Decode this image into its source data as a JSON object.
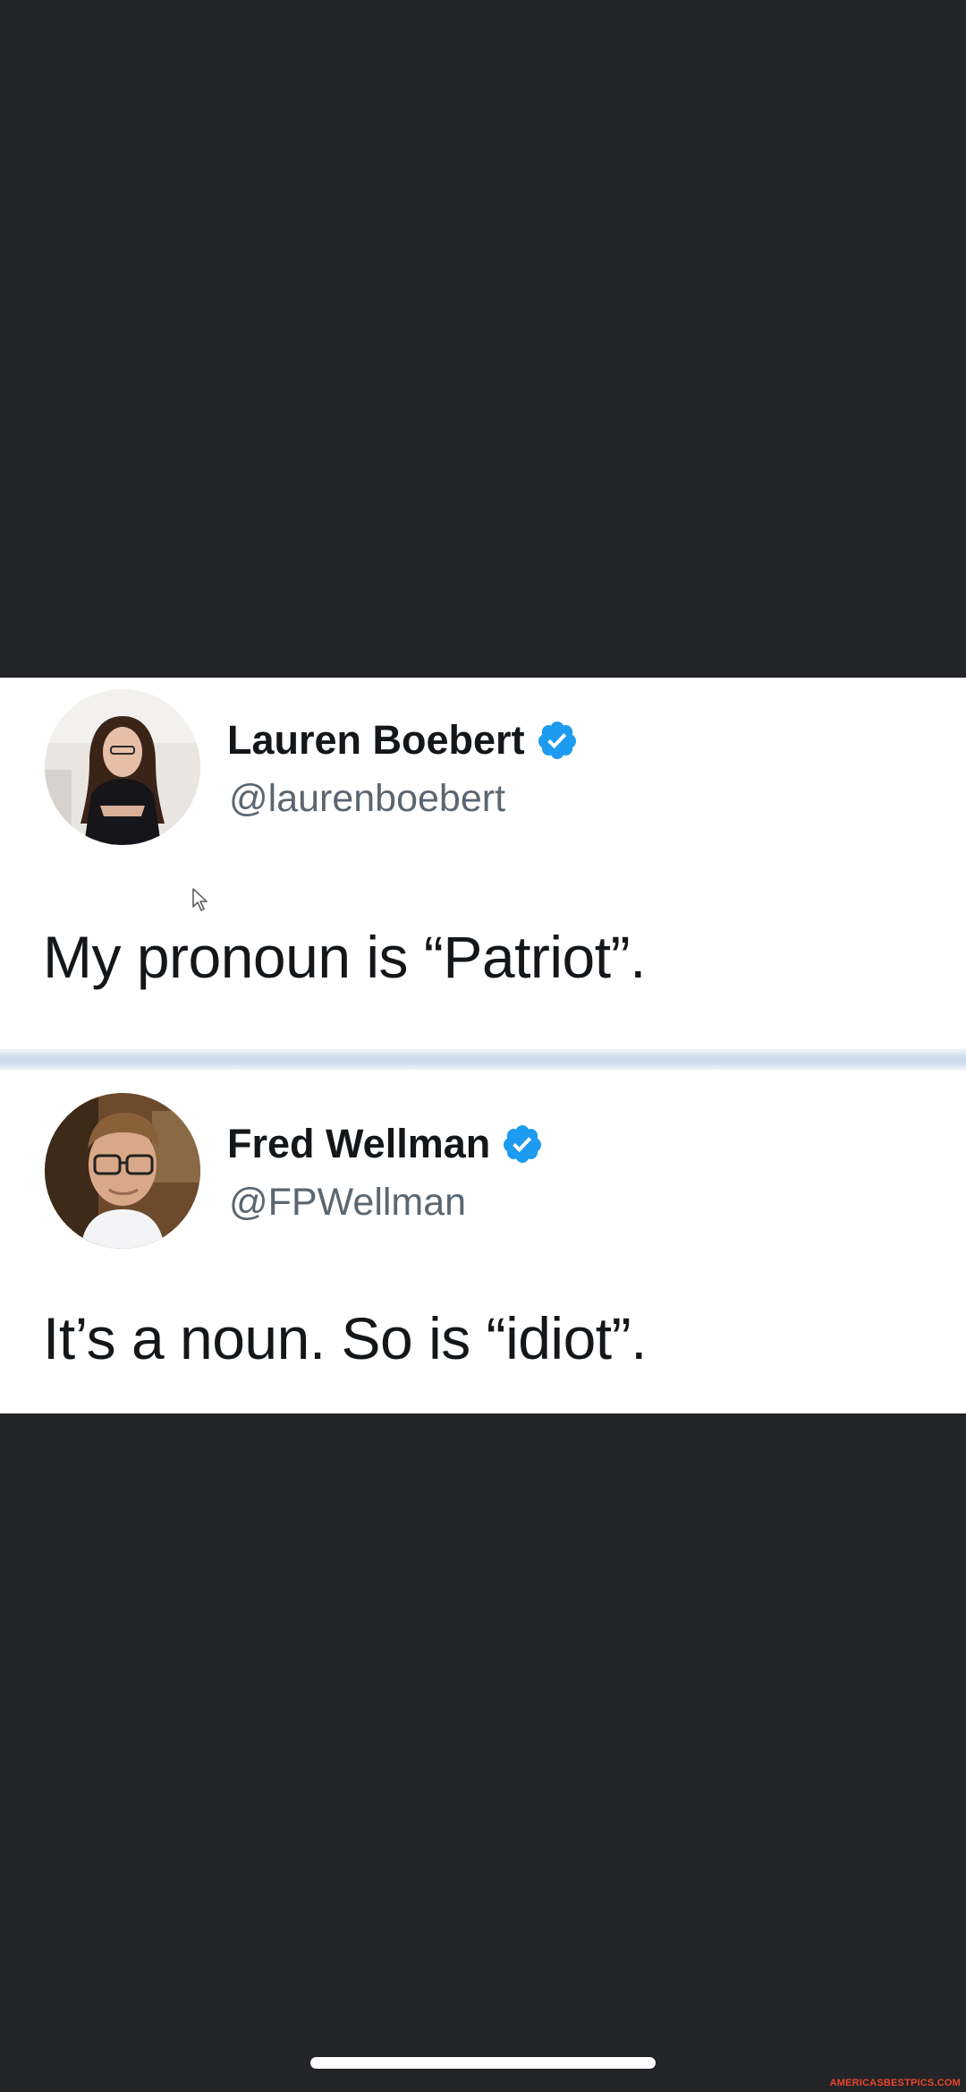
{
  "tweets": [
    {
      "display_name": "Lauren Boebert",
      "handle": "@laurenboebert",
      "text": "My pronoun is “Patriot”.",
      "verified": true
    },
    {
      "display_name": "Fred Wellman",
      "handle": "@FPWellman",
      "text": "It’s a noun. So is “idiot”.",
      "verified": true
    }
  ],
  "watermark": "AMERICASBESTPICS.COM",
  "colors": {
    "background": "#232427",
    "card": "#ffffff",
    "verified": "#1d9bf0",
    "watermark": "#e8452e"
  },
  "icons": [
    "verified-badge-icon",
    "mouse-cursor-icon"
  ]
}
